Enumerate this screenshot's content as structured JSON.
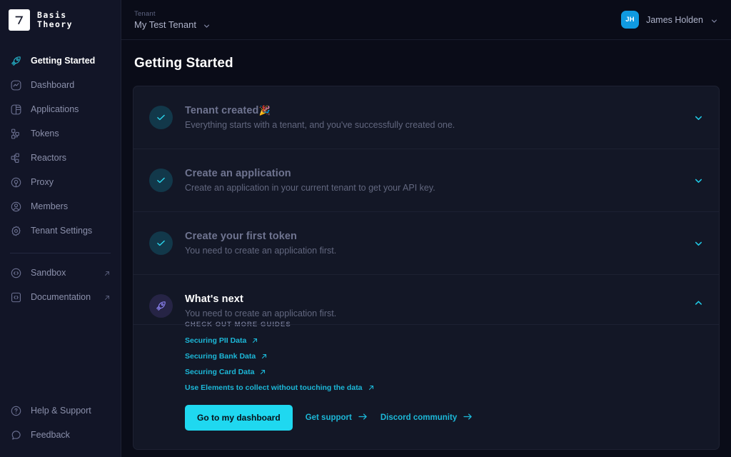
{
  "brand": {
    "name": "Basis\nTheory",
    "logo_icon": "basis-theory-logo"
  },
  "sidebar": {
    "items": [
      {
        "label": "Getting Started",
        "icon": "rocket-icon",
        "active": true,
        "external": false
      },
      {
        "label": "Dashboard",
        "icon": "chart-square-icon",
        "active": false,
        "external": false
      },
      {
        "label": "Applications",
        "icon": "applications-icon",
        "active": false,
        "external": false
      },
      {
        "label": "Tokens",
        "icon": "tokens-icon",
        "active": false,
        "external": false
      },
      {
        "label": "Reactors",
        "icon": "reactors-icon",
        "active": false,
        "external": false
      },
      {
        "label": "Proxy",
        "icon": "proxy-icon",
        "active": false,
        "external": false
      },
      {
        "label": "Members",
        "icon": "user-circle-icon",
        "active": false,
        "external": false
      },
      {
        "label": "Tenant Settings",
        "icon": "gear-icon",
        "active": false,
        "external": false
      }
    ],
    "external_items": [
      {
        "label": "Sandbox",
        "icon": "code-circle-icon",
        "external": true
      },
      {
        "label": "Documentation",
        "icon": "book-code-icon",
        "external": true
      }
    ],
    "bottom_items": [
      {
        "label": "Help & Support",
        "icon": "question-circle-icon"
      },
      {
        "label": "Feedback",
        "icon": "chat-bubble-icon"
      }
    ]
  },
  "topbar": {
    "tenant_label": "Tenant",
    "tenant_name": "My Test Tenant",
    "tenant_chevron_icon": "chevron-down-icon",
    "user_initials": "JH",
    "user_name": "James Holden",
    "user_chevron_icon": "chevron-down-icon"
  },
  "main": {
    "page_title": "Getting Started",
    "steps": [
      {
        "title": "Tenant created",
        "emoji": "🎉",
        "desc": "Everything starts with a tenant, and you've successfully created one.",
        "state": "done",
        "icon": "check-icon",
        "chevron": "chevron-down-icon",
        "expanded": false
      },
      {
        "title": "Create an application",
        "emoji": "",
        "desc": "Create an application in your current tenant to get your API key.",
        "state": "done",
        "icon": "check-icon",
        "chevron": "chevron-down-icon",
        "expanded": false
      },
      {
        "title": "Create your first token",
        "emoji": "",
        "desc": "You need to create an application first.",
        "state": "done",
        "icon": "check-icon",
        "chevron": "chevron-down-icon",
        "expanded": false
      },
      {
        "title": "What's next",
        "emoji": "",
        "desc": "You need to create an application first.",
        "state": "next",
        "icon": "rocket-icon",
        "chevron": "chevron-up-icon",
        "expanded": true
      }
    ],
    "guides_heading": "CHECK OUT MORE GUIDES",
    "guides": [
      {
        "label": "Securing PII Data",
        "icon": "external-link-icon"
      },
      {
        "label": "Securing Bank Data",
        "icon": "external-link-icon"
      },
      {
        "label": "Securing Card Data",
        "icon": "external-link-icon"
      },
      {
        "label": "Use Elements to collect without touching the data",
        "icon": "external-link-icon"
      }
    ],
    "actions": {
      "primary_label": "Go to my dashboard",
      "support_label": "Get support",
      "discord_label": "Discord community",
      "arrow_icon": "arrow-right-icon"
    }
  },
  "colors": {
    "page_bg": "#0a0c18",
    "sidebar_bg": "#121527",
    "card_bg": "#131726",
    "accent_cyan": "#1fd8f0",
    "link_cyan": "#1cb8d8",
    "avatar_blue": "#109ae0",
    "rocket_purple": "#7b74e0"
  }
}
